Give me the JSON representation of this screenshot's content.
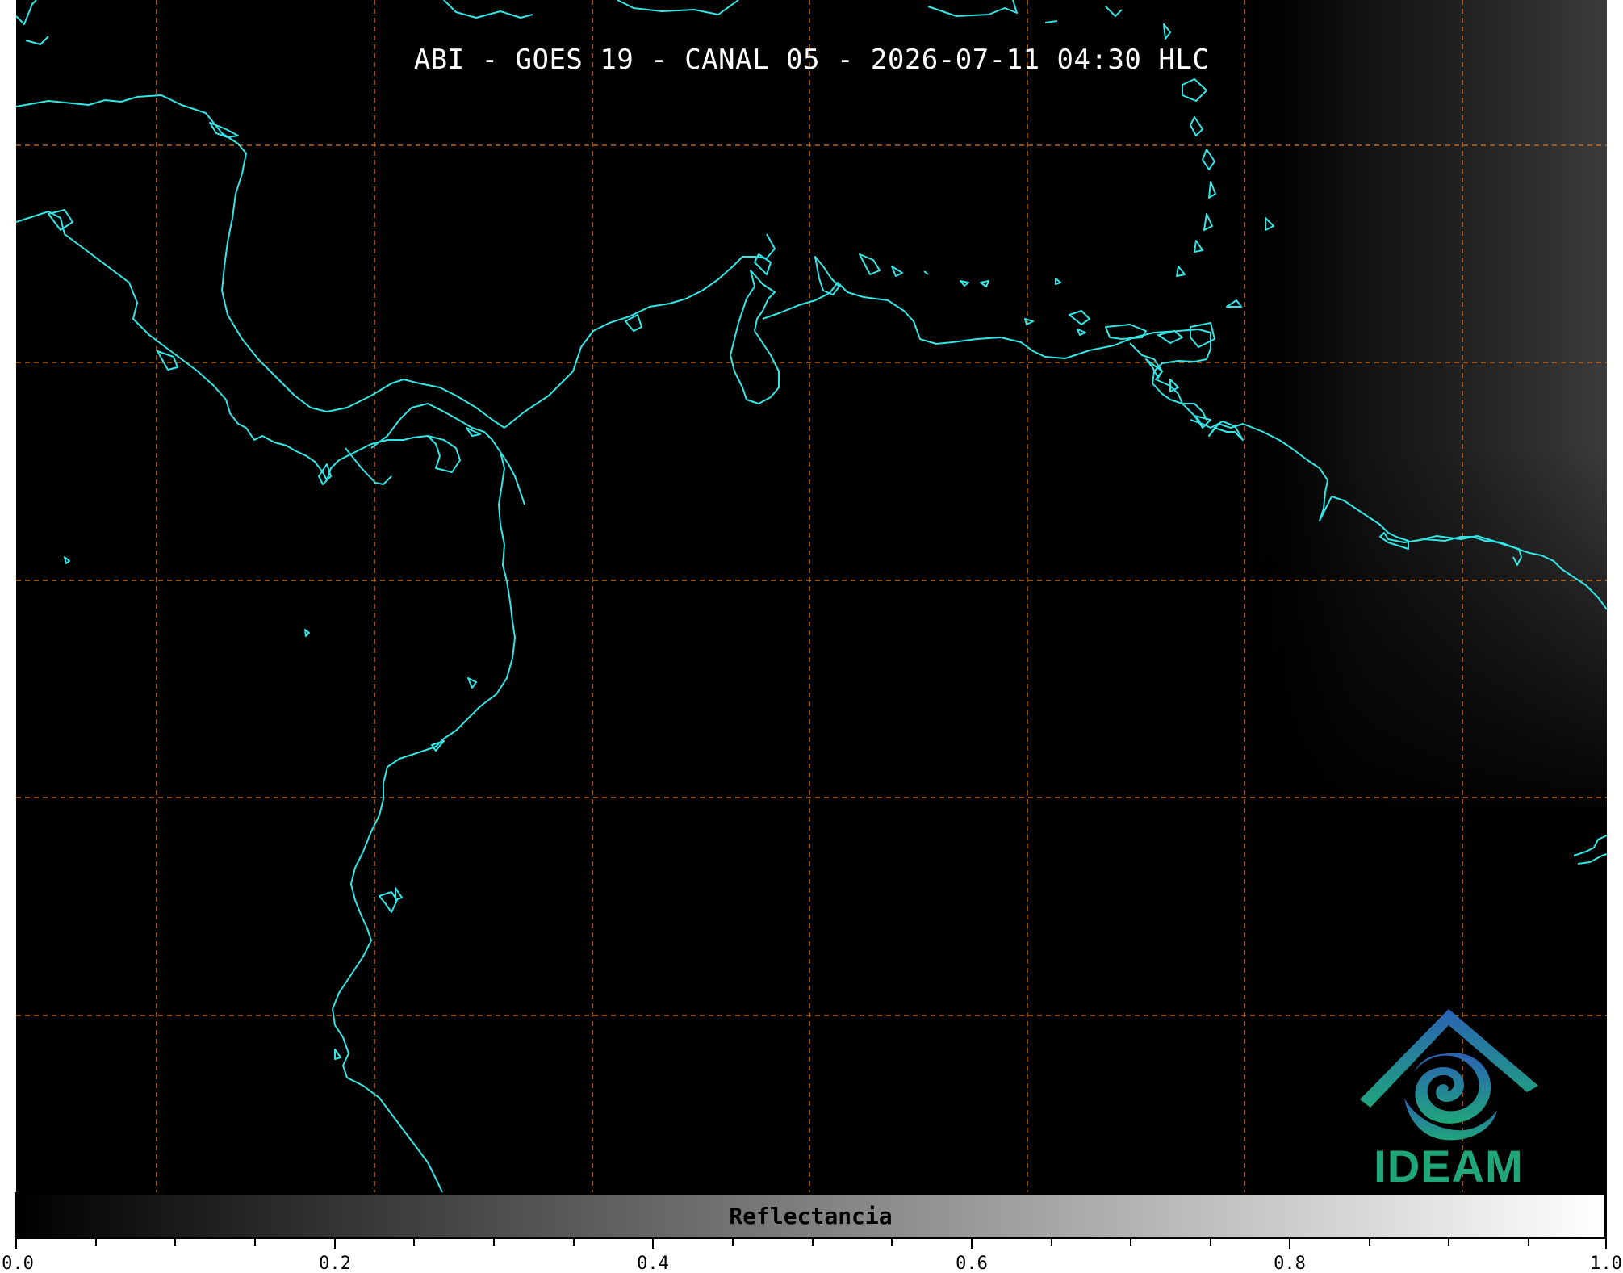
{
  "title": "ABI - GOES 19 - CANAL 05 - 2026-07-11 04:30 HLC",
  "colorbar": {
    "label": "Reflectancia",
    "range": [
      0.0,
      1.0
    ],
    "colormap": "grayscale",
    "ticks": [
      "0.0",
      "0.2",
      "0.4",
      "0.6",
      "0.8",
      "1.0"
    ]
  },
  "logo": {
    "text": "IDEAM",
    "colors": {
      "primary": "#1fa67a",
      "secondary": "#2b62b5"
    }
  },
  "colors": {
    "background": "#000000",
    "coastline": "#33e6e6",
    "gridlines": "#e07a1f"
  },
  "map": {
    "gridlines": "dashed",
    "coastlines": true
  }
}
